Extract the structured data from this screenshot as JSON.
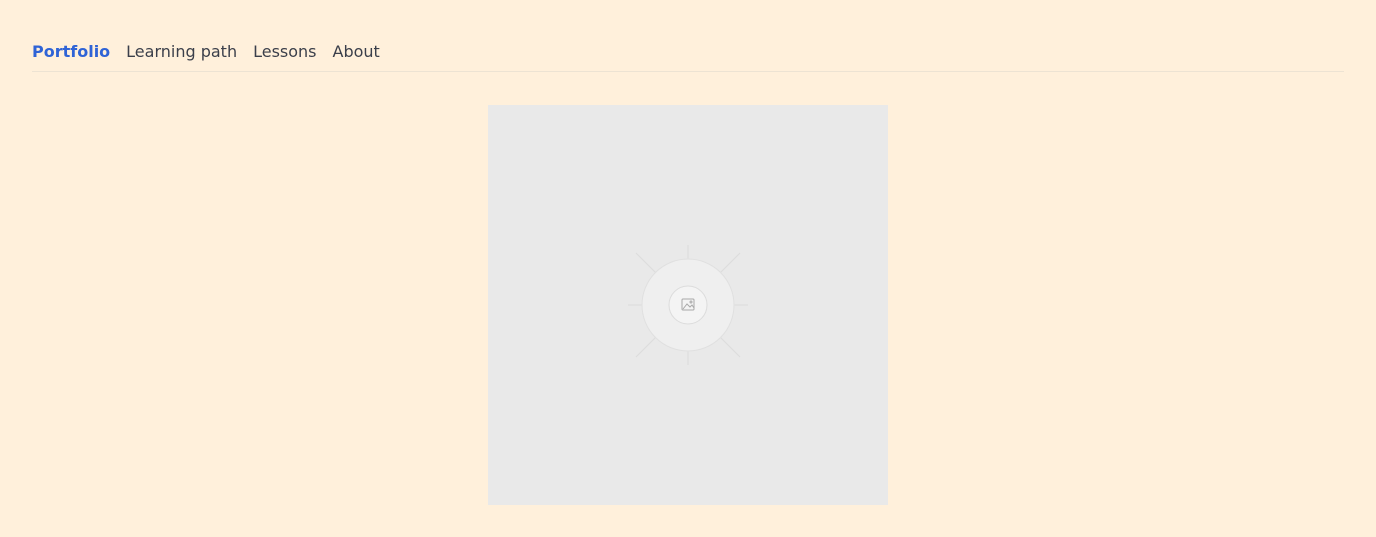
{
  "nav": {
    "items": [
      {
        "label": "Portfolio",
        "active": true
      },
      {
        "label": "Learning path",
        "active": false
      },
      {
        "label": "Lessons",
        "active": false
      },
      {
        "label": "About",
        "active": false
      }
    ]
  },
  "image": {
    "icon": "image-icon"
  },
  "colors": {
    "background": "#FFF0DB",
    "accent": "#2F63D6",
    "text": "#3B3F4A",
    "placeholder": "#E9E9E9"
  }
}
